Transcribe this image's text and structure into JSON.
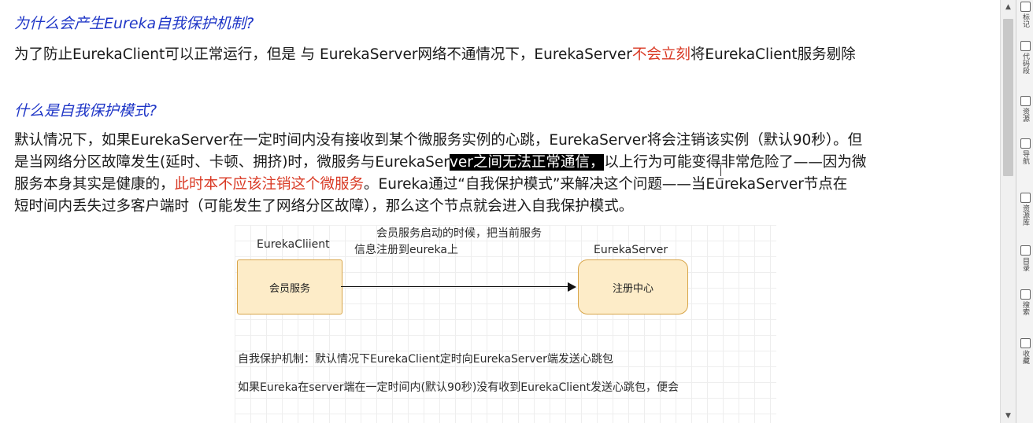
{
  "document": {
    "heading1": "为什么会产生Eureka自我保护机制?",
    "para1": {
      "before": "为了防止EurekaClient可以正常运行，但是 与 EurekaServer网络不通情况下，EurekaServer",
      "red": "不会立刻",
      "after": "将EurekaClient服务剔除"
    },
    "heading2": "什么是自我保护模式?",
    "para2": {
      "line1": "默认情况下，如果EurekaServer在一定时间内没有接收到某个微服务实例的心跳，EurekaServer将会注销该实例（默认90秒）。但",
      "line2_before": "是当网络分区故障发生(延时、卡顿、拥挤)时，微服务与EurekaSer",
      "line2_selected": "ver之间无法正常通信，",
      "line2_after": "以上行为可能变得非常危险了——因为微",
      "line3_before": "服务本身其实是健康的，",
      "line3_red": "此时本不应该注销这个微服务",
      "line3_after": "。Eureka通过“自我保护模式”来解决这个问题——当EurekaServer节点在",
      "line4": "短时间内丢失过多客户端时（可能发生了网络分区故障），那么这个节点就会进入自我保护模式。"
    }
  },
  "figure": {
    "client_label": "EurekaCliient",
    "server_label": "EurekaServer",
    "arrow_caption_line1": "会员服务启动的时候，把当前服务",
    "arrow_caption_line2": "信息注册到eureka上",
    "client_box": "会员服务",
    "server_box": "注册中心",
    "note_line1": "自我保护机制：默认情况下EurekaClient定时向EurekaServer端发送心跳包",
    "note_line2": "如果Eureka在server端在一定时间内(默认90秒)没有收到EurekaClient发送心跳包，便会"
  },
  "colors": {
    "heading": "#1f36c7",
    "emphasis": "#d93a25",
    "box_fill": "#fdecc8",
    "box_border": "#d8a54a"
  },
  "scrollbar": {
    "up_icon": "triangle-up",
    "down_icon": "triangle-down"
  },
  "side_panel": [
    {
      "label": "标记",
      "icon": "bookmark-icon"
    },
    {
      "label": "代码段",
      "icon": "code-icon"
    },
    {
      "label": "资源",
      "icon": "resource-icon"
    },
    {
      "label": "导航",
      "icon": "nav-icon"
    },
    {
      "label": "资源库",
      "icon": "library-icon"
    },
    {
      "label": "目录",
      "icon": "outline-icon"
    },
    {
      "label": "搜索",
      "icon": "search-icon"
    },
    {
      "label": "收藏",
      "icon": "favorite-icon"
    }
  ]
}
